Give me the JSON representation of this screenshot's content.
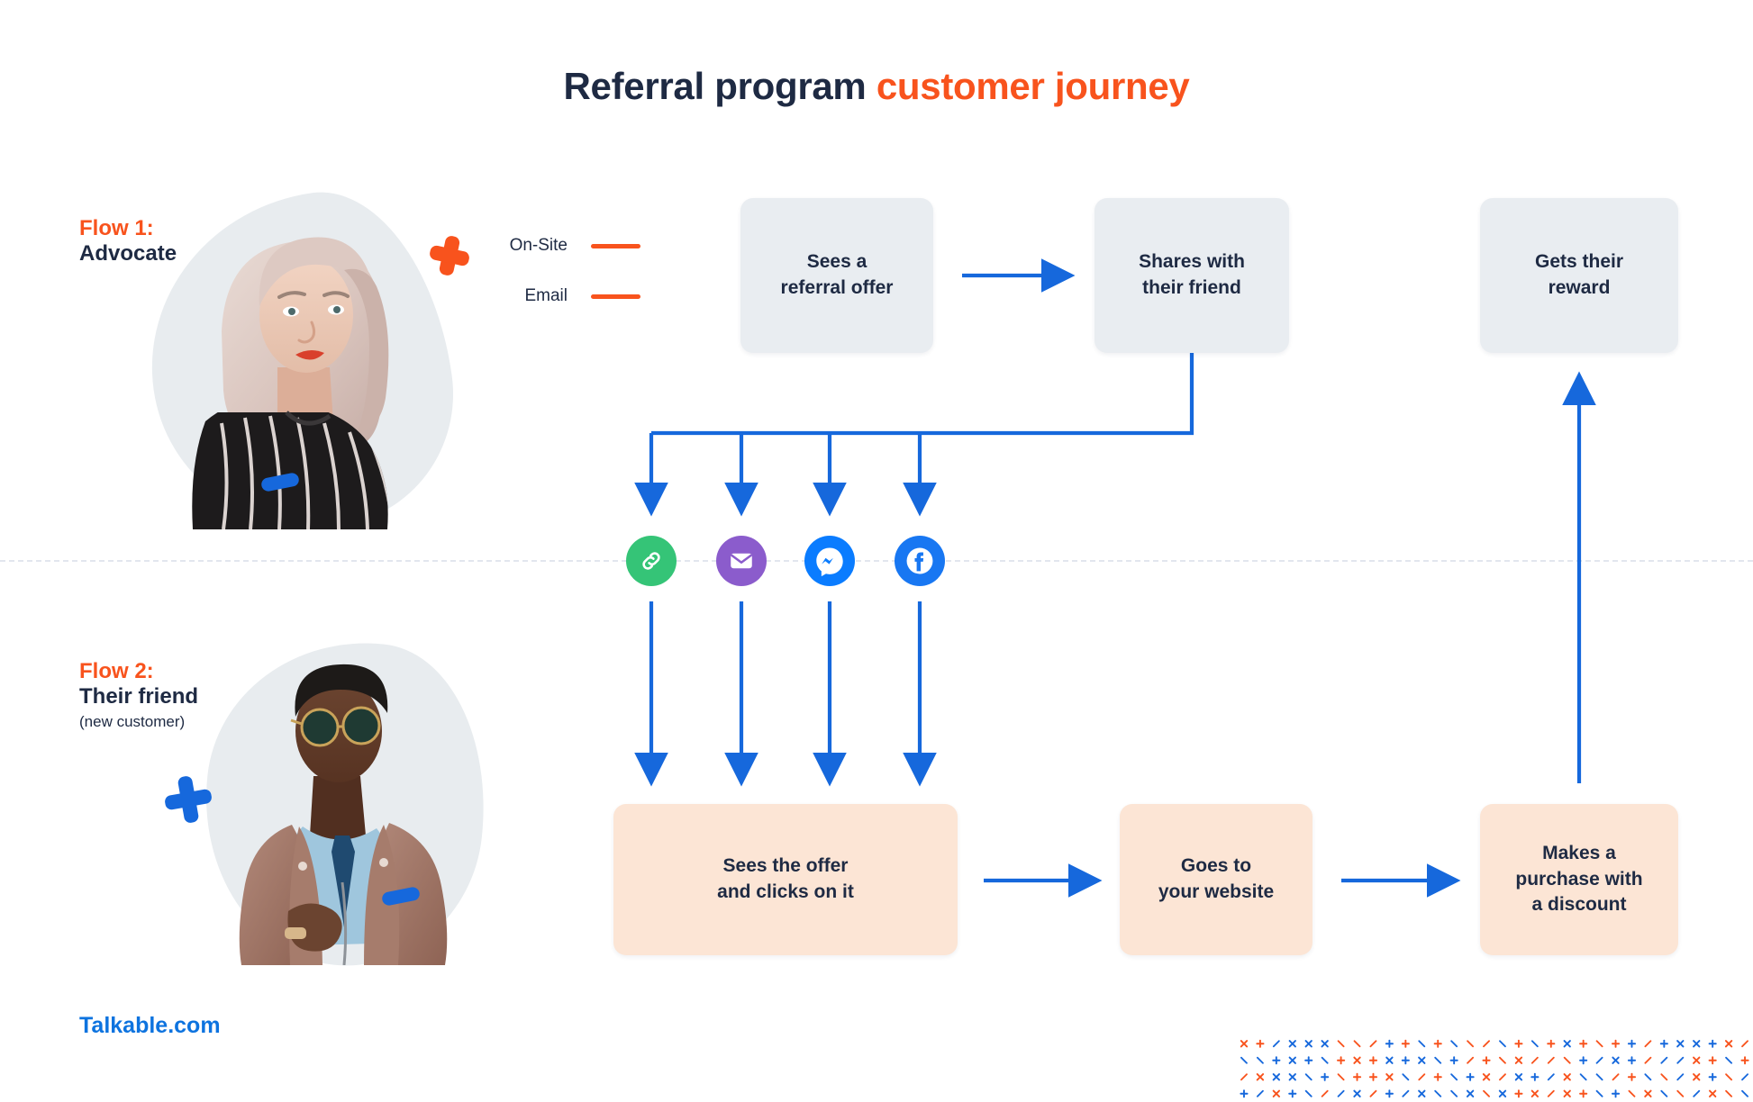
{
  "title": {
    "primary": "Referral program ",
    "accent": "customer journey"
  },
  "colors": {
    "accent_orange": "#f8531d",
    "dark_navy": "#1e2a43",
    "arrow_blue": "#1668dc",
    "brand_blue": "#0d73df",
    "node_gray": "#e9edf1",
    "node_peach": "#fce5d5",
    "blob_gray": "#e8ecef"
  },
  "flows": {
    "flow1": {
      "kicker": "Flow 1:",
      "name": "Advocate",
      "sub": ""
    },
    "flow2": {
      "kicker": "Flow 2:",
      "name": "Their friend",
      "sub": "(new customer)"
    }
  },
  "legend": {
    "onsite": "On-Site",
    "email": "Email"
  },
  "nodes": {
    "sees_offer": "Sees a\nreferral offer",
    "shares": "Shares with\ntheir friend",
    "reward": "Gets their\nreward",
    "sees_clicks": "Sees the offer\nand clicks on it",
    "website": "Goes to\nyour website",
    "purchase": "Makes a\npurchase with\na discount"
  },
  "channels": [
    {
      "id": "link",
      "name": "link-icon",
      "color": "#35c477"
    },
    {
      "id": "email",
      "name": "email-icon",
      "color": "#8b5ccc"
    },
    {
      "id": "messenger",
      "name": "messenger-icon",
      "color": "#0a7cff"
    },
    {
      "id": "facebook",
      "name": "facebook-icon",
      "color": "#1877f2"
    }
  ],
  "brand": "Talkable.com"
}
